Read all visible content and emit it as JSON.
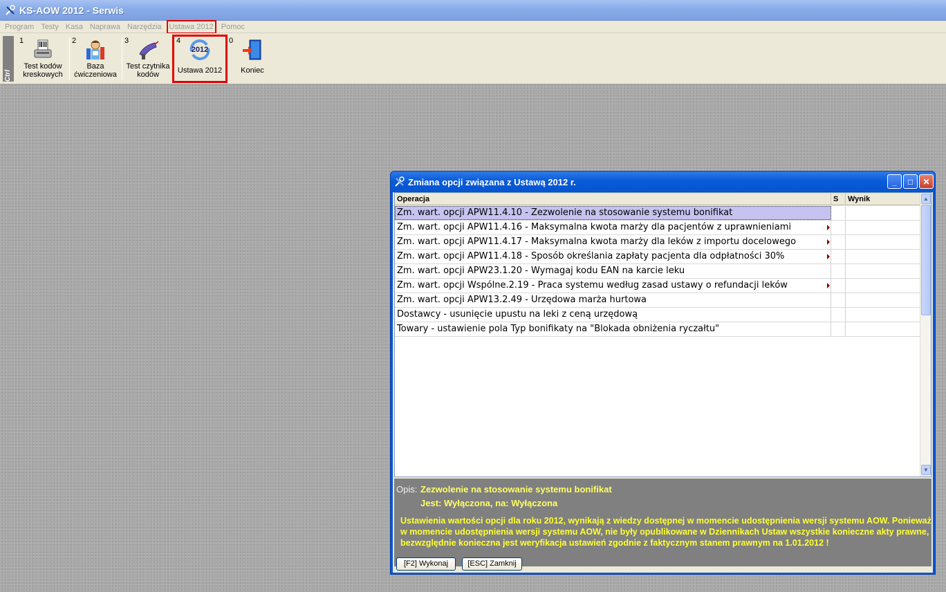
{
  "app": {
    "title": "KS-AOW 2012 - Serwis",
    "accent": "#e00000"
  },
  "menu": [
    {
      "label": "Program"
    },
    {
      "label": "Testy"
    },
    {
      "label": "Kasa"
    },
    {
      "label": "Naprawa"
    },
    {
      "label": "Narzędzia"
    },
    {
      "label": "Ustawa 2012",
      "highlighted": true
    },
    {
      "label": "Pomoc"
    }
  ],
  "toolbar": {
    "ctrl_label": "Ctrl",
    "buttons": [
      {
        "num": "1",
        "label": "Test kodów kreskowych",
        "icon": "barcode-scanner-icon"
      },
      {
        "num": "2",
        "label": "Baza ćwiczeniowa",
        "icon": "student-books-icon"
      },
      {
        "num": "3",
        "label": "Test czytnika kodów",
        "icon": "scanner-gun-icon"
      },
      {
        "num": "4",
        "label": "Ustawa 2012",
        "icon": "ustawa-2012-icon",
        "icon_text": "2012",
        "highlighted": true
      },
      {
        "num": "0",
        "label": "Koniec",
        "icon": "exit-door-icon"
      }
    ]
  },
  "dialog": {
    "title": "Zmiana opcji związana z Ustawą 2012 r.",
    "columns": {
      "operation": "Operacja",
      "s": "S",
      "result": "Wynik"
    },
    "rows": [
      {
        "op": "Zm. wart. opcji APW11.4.10 - Zezwolenie na stosowanie systemu bonifikat",
        "selected": true,
        "truncated": false
      },
      {
        "op": "Zm. wart. opcji APW11.4.16 - Maksymalna kwota marży dla pacjentów z uprawnieniami",
        "truncated": true
      },
      {
        "op": "Zm. wart. opcji APW11.4.17 - Maksymalna kwota marży dla leków z importu docelowego",
        "truncated": true
      },
      {
        "op": "Zm. wart. opcji APW11.4.18 - Sposób określania zapłaty pacjenta dla odpłatności 30%",
        "truncated": true
      },
      {
        "op": "Zm. wart. opcji APW23.1.20 - Wymagaj kodu EAN na karcie leku",
        "truncated": false
      },
      {
        "op": "Zm. wart. opcji Wspólne.2.19 - Praca systemu według zasad ustawy o refundacji leków",
        "truncated": true
      },
      {
        "op": "Zm. wart. opcji APW13.2.49 - Urzędowa marża hurtowa",
        "truncated": false
      },
      {
        "op": "Dostawcy - usunięcie upustu na leki z ceną urzędową",
        "truncated": false
      },
      {
        "op": "Towary - ustawienie pola Typ bonifikaty na \"Blokada obniżenia ryczałtu\"",
        "truncated": false
      }
    ],
    "description": {
      "label": "Opis:",
      "value": "Zezwolenie na stosowanie systemu bonifikat",
      "state": "Jest: Wyłączona,  na: Wyłączona",
      "warning": "Ustawienia wartości opcji dla roku 2012, wynikają z wiedzy dostępnej w momencie udostępnienia wersji systemu AOW. Ponieważ w momencie udostępnienia wersji systemu AOW, nie były opublikowane w Dziennikach Ustaw wszystkie konieczne akty prawne, bezwzględnie konieczna jest weryfikacja ustawień zgodnie z faktycznym stanem prawnym na 1.01.2012 !"
    },
    "buttons": {
      "execute": "[F2] Wykonaj",
      "close": "[ESC] Zamknij"
    },
    "window_controls": {
      "minimize": "_",
      "maximize": "□",
      "close": "✕"
    }
  }
}
